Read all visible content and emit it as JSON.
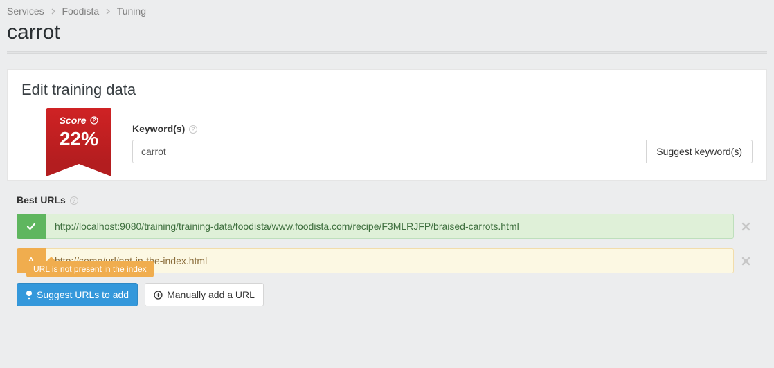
{
  "breadcrumb": {
    "item0": "Services",
    "item1": "Foodista",
    "item2": "Tuning"
  },
  "page_title": "carrot",
  "panel_title": "Edit training data",
  "score": {
    "label": "Score",
    "value": "22%"
  },
  "keywords": {
    "label": "Keyword(s)",
    "value": "carrot",
    "suggest_btn": "Suggest keyword(s)"
  },
  "best_urls_label": "Best URLs",
  "urls": [
    {
      "status": "ok",
      "value": "http://localhost:9080/training/training-data/foodista/www.foodista.com/recipe/F3MLRJFP/braised-carrots.html"
    },
    {
      "status": "warn",
      "value": "http://some/url/not-in-the-index.html"
    }
  ],
  "warn_tooltip": "URL is not present in the index",
  "buttons": {
    "suggest_urls": "Suggest URLs to add",
    "manual_add": "Manually add a URL"
  }
}
